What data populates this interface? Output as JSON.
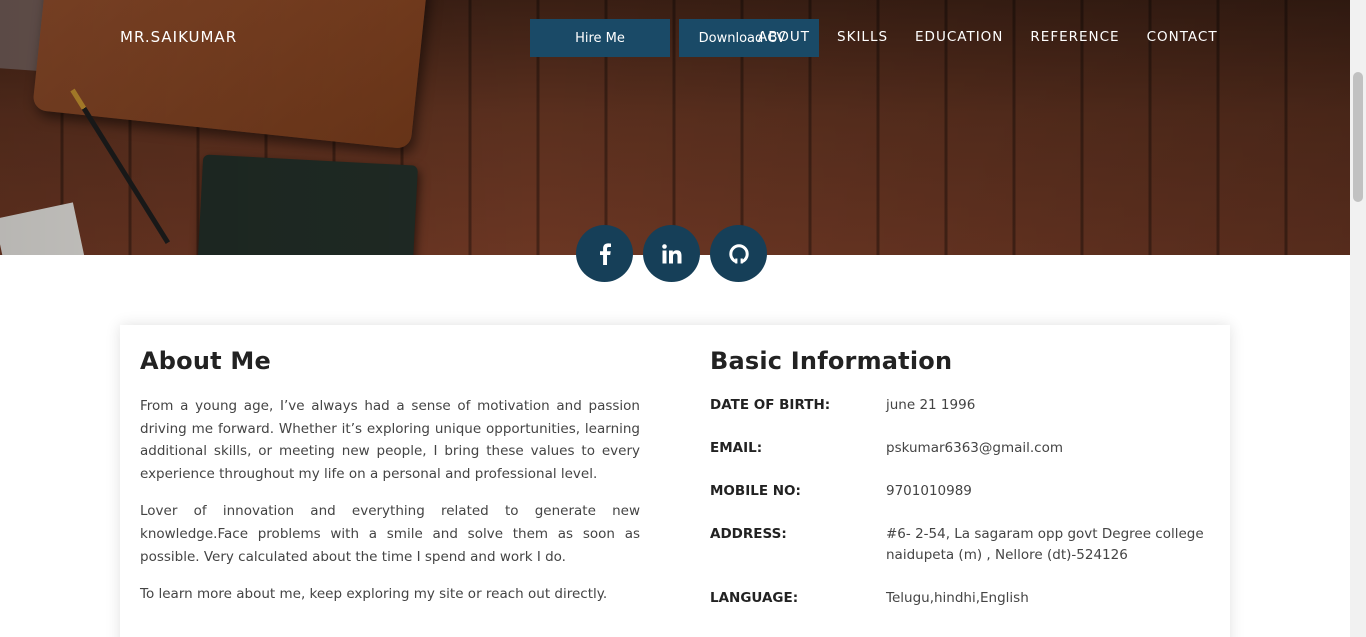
{
  "brand": "MR.SAIKUMAR",
  "buttons": {
    "hire": "Hire Me",
    "download": "Download CV"
  },
  "nav": {
    "items": [
      "ABOUT",
      "SKILLS",
      "EDUCATION",
      "REFERENCE",
      "CONTACT"
    ]
  },
  "social": {
    "icons": [
      "facebook-icon",
      "linkedin-icon",
      "github-icon"
    ]
  },
  "about": {
    "title": "About Me",
    "paragraphs": [
      "From a young age, I’ve always had a sense of motivation and passion driving me forward. Whether it’s exploring unique opportunities, learning additional skills, or meeting new people, I bring these values to every experience throughout my life on a personal and professional level.",
      "Lover of innovation and everything related to generate new knowledge.Face problems with a smile and solve them as soon as possible. Very calculated about the time I spend and work I do.",
      "To learn more about me, keep exploring my site or reach out directly."
    ]
  },
  "basic": {
    "title": "Basic Information",
    "rows": [
      {
        "label": "DATE OF BIRTH:",
        "value": "june 21 1996"
      },
      {
        "label": "EMAIL:",
        "value": "pskumar6363@gmail.com"
      },
      {
        "label": "MOBILE NO:",
        "value": "9701010989"
      },
      {
        "label": "ADDRESS:",
        "value": "#6- 2-54, La sagaram opp govt Degree college naidupeta (m) , Nellore (dt)-524126"
      },
      {
        "label": "LANGUAGE:",
        "value": "Telugu,hindhi,English"
      }
    ]
  },
  "colors": {
    "button_bg": "#1a4a67",
    "social_bg": "#163f58"
  }
}
